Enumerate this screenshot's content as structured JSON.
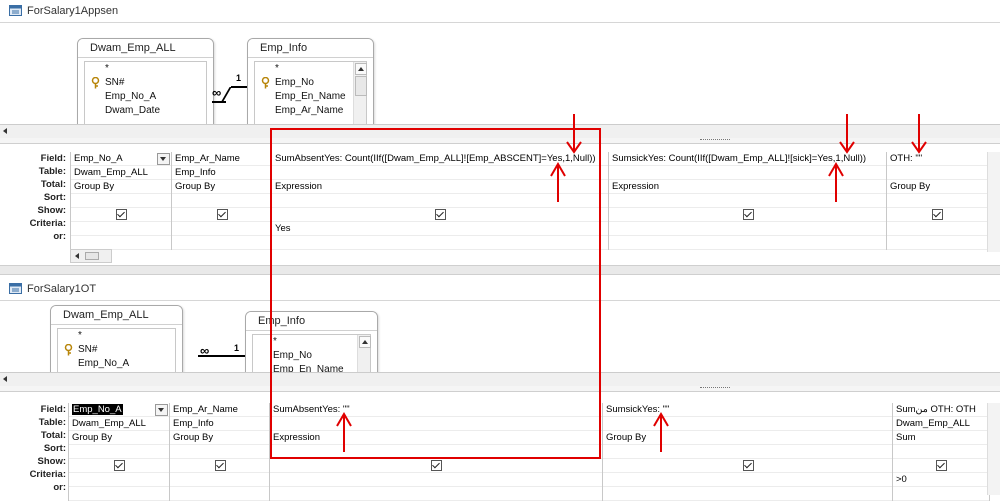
{
  "accent_red": "#e00000",
  "row_labels": [
    "Field:",
    "Table:",
    "Total:",
    "Sort:",
    "Show:",
    "Criteria:",
    "or:"
  ],
  "query1": {
    "title": "ForSalary1Appsen",
    "tables": [
      {
        "name": "Dwam_Emp_ALL",
        "fields": [
          "*",
          "SN#",
          "Emp_No_A",
          "Dwam_Date"
        ]
      },
      {
        "name": "Emp_Info",
        "fields": [
          "*",
          "Emp_No",
          "Emp_En_Name",
          "Emp_Ar_Name"
        ]
      }
    ],
    "join": {
      "left": "∞",
      "right": "1"
    },
    "columns": [
      {
        "field": "Emp_No_A",
        "table": "Dwam_Emp_ALL",
        "total": "Group By",
        "sort": "",
        "show": true,
        "criteria": "",
        "or": ""
      },
      {
        "field": "Emp_Ar_Name",
        "table": "Emp_Info",
        "total": "Group By",
        "sort": "",
        "show": true,
        "criteria": "",
        "or": ""
      },
      {
        "field": "SumAbsentYes: Count(IIf([Dwam_Emp_ALL]![Emp_ABSCENT]=Yes,1,Null))",
        "table": "",
        "total": "Expression",
        "sort": "",
        "show": true,
        "criteria": "Yes",
        "or": ""
      },
      {
        "field": "SumsickYes: Count(IIf([Dwam_Emp_ALL]![sick]=Yes,1,Null))",
        "table": "",
        "total": "Expression",
        "sort": "",
        "show": true,
        "criteria": "",
        "or": ""
      },
      {
        "field": "OTH: \"\"",
        "table": "",
        "total": "Group By",
        "sort": "",
        "show": true,
        "criteria": "",
        "or": ""
      }
    ]
  },
  "query2": {
    "title": "ForSalary1OT",
    "tables": [
      {
        "name": "Dwam_Emp_ALL",
        "fields": [
          "*",
          "SN#",
          "Emp_No_A"
        ]
      },
      {
        "name": "Emp_Info",
        "fields": [
          "*",
          "Emp_No",
          "Emp_En_Name"
        ]
      }
    ],
    "join": {
      "left": "∞",
      "right": "1"
    },
    "columns": [
      {
        "field": "Emp_No_A",
        "table": "Dwam_Emp_ALL",
        "total": "Group By",
        "sort": "",
        "show": true,
        "criteria": "",
        "or": ""
      },
      {
        "field": "Emp_Ar_Name",
        "table": "Emp_Info",
        "total": "Group By",
        "sort": "",
        "show": true,
        "criteria": "",
        "or": ""
      },
      {
        "field": "SumAbsentYes: \"\"",
        "table": "",
        "total": "Expression",
        "sort": "",
        "show": true,
        "criteria": "",
        "or": ""
      },
      {
        "field": "SumsickYes: \"\"",
        "table": "",
        "total": "Group By",
        "sort": "",
        "show": true,
        "criteria": "",
        "or": ""
      },
      {
        "field": "Sumمن OTH: OTH",
        "table": "Dwam_Emp_ALL",
        "total": "Sum",
        "sort": "",
        "show": true,
        "criteria": ">0",
        "or": ""
      }
    ]
  }
}
